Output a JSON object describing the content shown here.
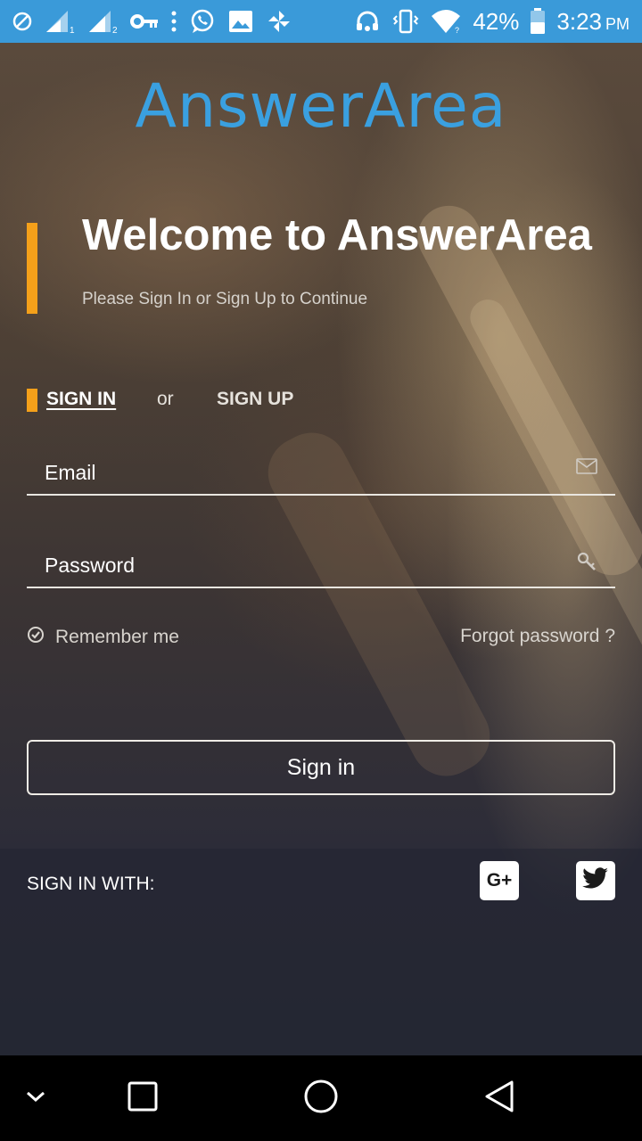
{
  "status_bar": {
    "battery": "42%",
    "time": "3:23",
    "ampm": "PM",
    "sim1": "1",
    "sim2": "2"
  },
  "logo": {
    "text": "AnswerArea"
  },
  "welcome": {
    "title": "Welcome to AnswerArea",
    "subtitle": "Please Sign In or Sign Up to Continue"
  },
  "tabs": {
    "signin": "SIGN IN",
    "or": "or",
    "signup": "SIGN UP"
  },
  "form": {
    "email_placeholder": "Email",
    "password_placeholder": "Password",
    "remember_label": "Remember me",
    "forgot_label": "Forgot password ?",
    "submit_label": "Sign in"
  },
  "social": {
    "label": "SIGN IN WITH:",
    "google_text": "G+"
  },
  "colors": {
    "status_bar": "#3a9ad9",
    "logo": "#3aa0e0",
    "accent": "#f4a01a"
  }
}
